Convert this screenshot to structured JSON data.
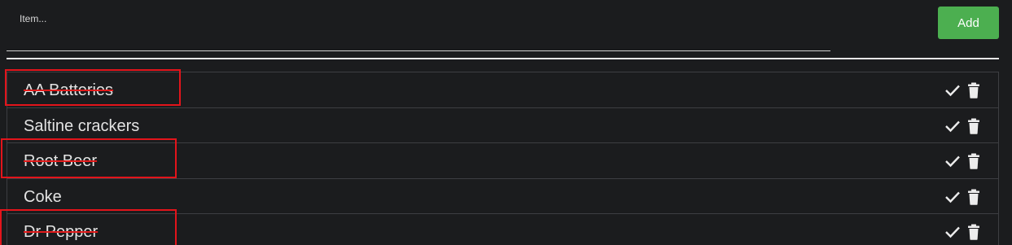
{
  "input": {
    "label": "Item...",
    "value": ""
  },
  "add_button": {
    "label": "Add"
  },
  "items": [
    {
      "name": "AA Batteries",
      "completed": true
    },
    {
      "name": "Saltine crackers",
      "completed": false
    },
    {
      "name": "Root Beer",
      "completed": true
    },
    {
      "name": "Coke",
      "completed": false
    },
    {
      "name": "Dr Pepper",
      "completed": true
    }
  ],
  "colors": {
    "background": "#1b1c1e",
    "add_button": "#4caf50",
    "strike": "#e21b1b",
    "highlight": "#e3141b",
    "text": "#e3e3e3"
  },
  "icons": {
    "complete": "check-icon",
    "delete": "trash-icon"
  }
}
